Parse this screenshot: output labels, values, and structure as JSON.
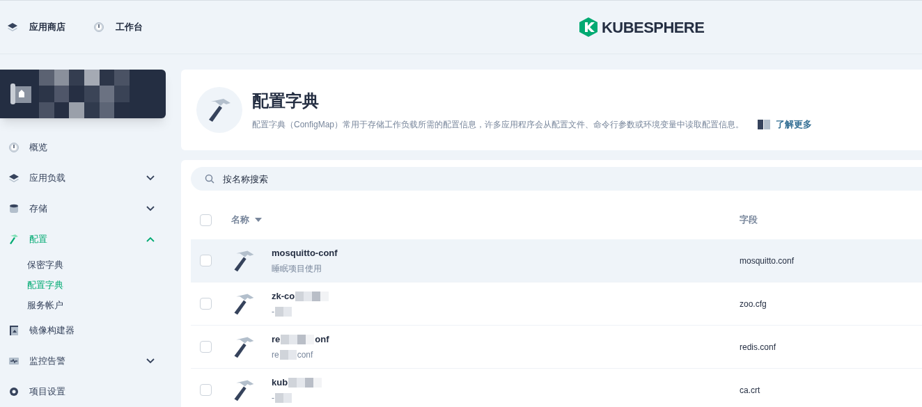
{
  "top_nav": [
    {
      "label": "应用商店",
      "kind": "layers"
    },
    {
      "label": "工作台",
      "kind": "dial"
    }
  ],
  "logo": {
    "text": "KUBESPHERE"
  },
  "sidebar": {
    "items": [
      {
        "label": "概览",
        "kind": "dial",
        "selected": false
      },
      {
        "label": "应用负载",
        "kind": "layers",
        "selected": false,
        "expanded": false
      },
      {
        "label": "存储",
        "kind": "db",
        "selected": false,
        "expanded": false
      },
      {
        "label": "配置",
        "kind": "hammer",
        "selected": true,
        "expanded": true,
        "children": [
          {
            "label": "保密字典",
            "selected": false
          },
          {
            "label": "配置字典",
            "selected": true
          },
          {
            "label": "服务帐户",
            "selected": false
          }
        ]
      },
      {
        "label": "镜像构建器",
        "kind": "builder",
        "selected": false
      },
      {
        "label": "监控告警",
        "kind": "monitor",
        "selected": false,
        "expanded": false
      },
      {
        "label": "项目设置",
        "kind": "gear",
        "selected": false
      }
    ]
  },
  "header": {
    "title": "配置字典",
    "description": "配置字典（ConfigMap）常用于存储工作负载所需的配置信息，许多应用程序会从配置文件、命令行参数或环境变量中读取配置信息。",
    "link": "了解更多"
  },
  "search": {
    "placeholder": "按名称搜索"
  },
  "table": {
    "select_all": {
      "checked": false
    },
    "columns": [
      {
        "label": "名称",
        "sortable": true
      },
      {
        "label": "字段",
        "sortable": false
      }
    ],
    "rows": [
      {
        "name": [
          "mosquitto-conf"
        ],
        "description": [
          "睡眠项目使用"
        ],
        "field": "mosquitto.conf",
        "hovered": true,
        "checked": false
      },
      {
        "name": [
          "zk-co"
        ],
        "description": [
          "-"
        ],
        "field": "zoo.cfg",
        "hovered": false,
        "checked": false
      },
      {
        "name": [
          "re",
          "onf"
        ],
        "description": [
          "re",
          "conf"
        ],
        "field": "redis.conf",
        "hovered": false,
        "checked": false
      },
      {
        "name": [
          "kub"
        ],
        "description": [
          "-"
        ],
        "field": "ca.crt",
        "hovered": false,
        "checked": false
      }
    ]
  }
}
